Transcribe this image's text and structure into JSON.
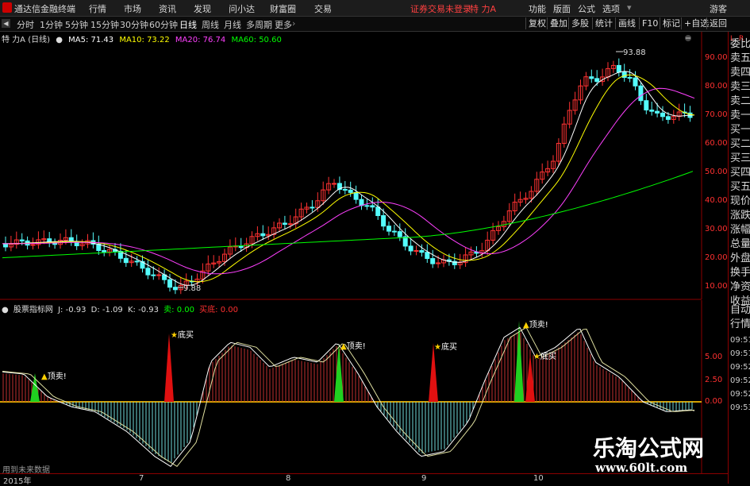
{
  "menu": {
    "app_title": "通达信金融终端",
    "items": [
      "行情",
      "市场",
      "资讯",
      "发现",
      "问小达",
      "财富圈",
      "交易"
    ],
    "login_status": "证券交易未登录",
    "stock_name": "特 力A",
    "right_items": [
      "功能",
      "版面",
      "公式",
      "选项"
    ],
    "user": "游客"
  },
  "periods": {
    "items": [
      "分时",
      "1分钟",
      "5分钟",
      "15分钟",
      "30分钟",
      "60分钟",
      "日线",
      "周线",
      "月线",
      "多周期",
      "更多"
    ],
    "active": "日线",
    "tools": [
      "复权",
      "叠加",
      "多股",
      "统计",
      "画线",
      "F10",
      "标记",
      "+自选",
      "返回"
    ]
  },
  "main_legend": {
    "title": "特 力A (日线)",
    "ma5": "MA5: 71.43",
    "ma10": "MA10: 73.22",
    "ma20": "MA20: 76.74",
    "ma60": "MA60: 50.60",
    "colors": {
      "ma5": "#ffffff",
      "ma10": "#ffff00",
      "ma20": "#ff40ff",
      "ma60": "#00ff00"
    },
    "high_label": "93.88",
    "low_label": "9.88"
  },
  "y_axis": [
    "90.00",
    "80.00",
    "70.00",
    "60.00",
    "50.00",
    "40.00",
    "30.00",
    "20.00",
    "10.00"
  ],
  "sub_legend": {
    "title": "股票指标网",
    "j": "J: -0.93",
    "d": "D: -1.09",
    "k": "K: -0.93",
    "sell": "卖: 0.00",
    "buy": "买底: 0.00",
    "axis": [
      "5.00",
      "2.50",
      "0.00"
    ],
    "signal_top": "顶卖!",
    "signal_bottom": "底买"
  },
  "right_panel": {
    "top": [
      "L",
      "R"
    ],
    "items": [
      "委比",
      "卖五",
      "卖四",
      "卖三",
      "卖二",
      "卖一",
      "买一",
      "买二",
      "买三",
      "买四",
      "买五",
      "现价",
      "涨跌",
      "涨幅",
      "总量",
      "外盘",
      "换手",
      "净资",
      "收益"
    ],
    "section": [
      "自动",
      "行情"
    ],
    "times": [
      "09:51",
      "09:51",
      "09:52",
      "09:52",
      "09:52",
      "09:53"
    ]
  },
  "x_axis": [
    "2015年",
    "7",
    "8",
    "9",
    "10"
  ],
  "future_note": "用到未来数据",
  "watermark": {
    "cn": "乐淘公式网",
    "url": "www.60lt.com"
  }
}
